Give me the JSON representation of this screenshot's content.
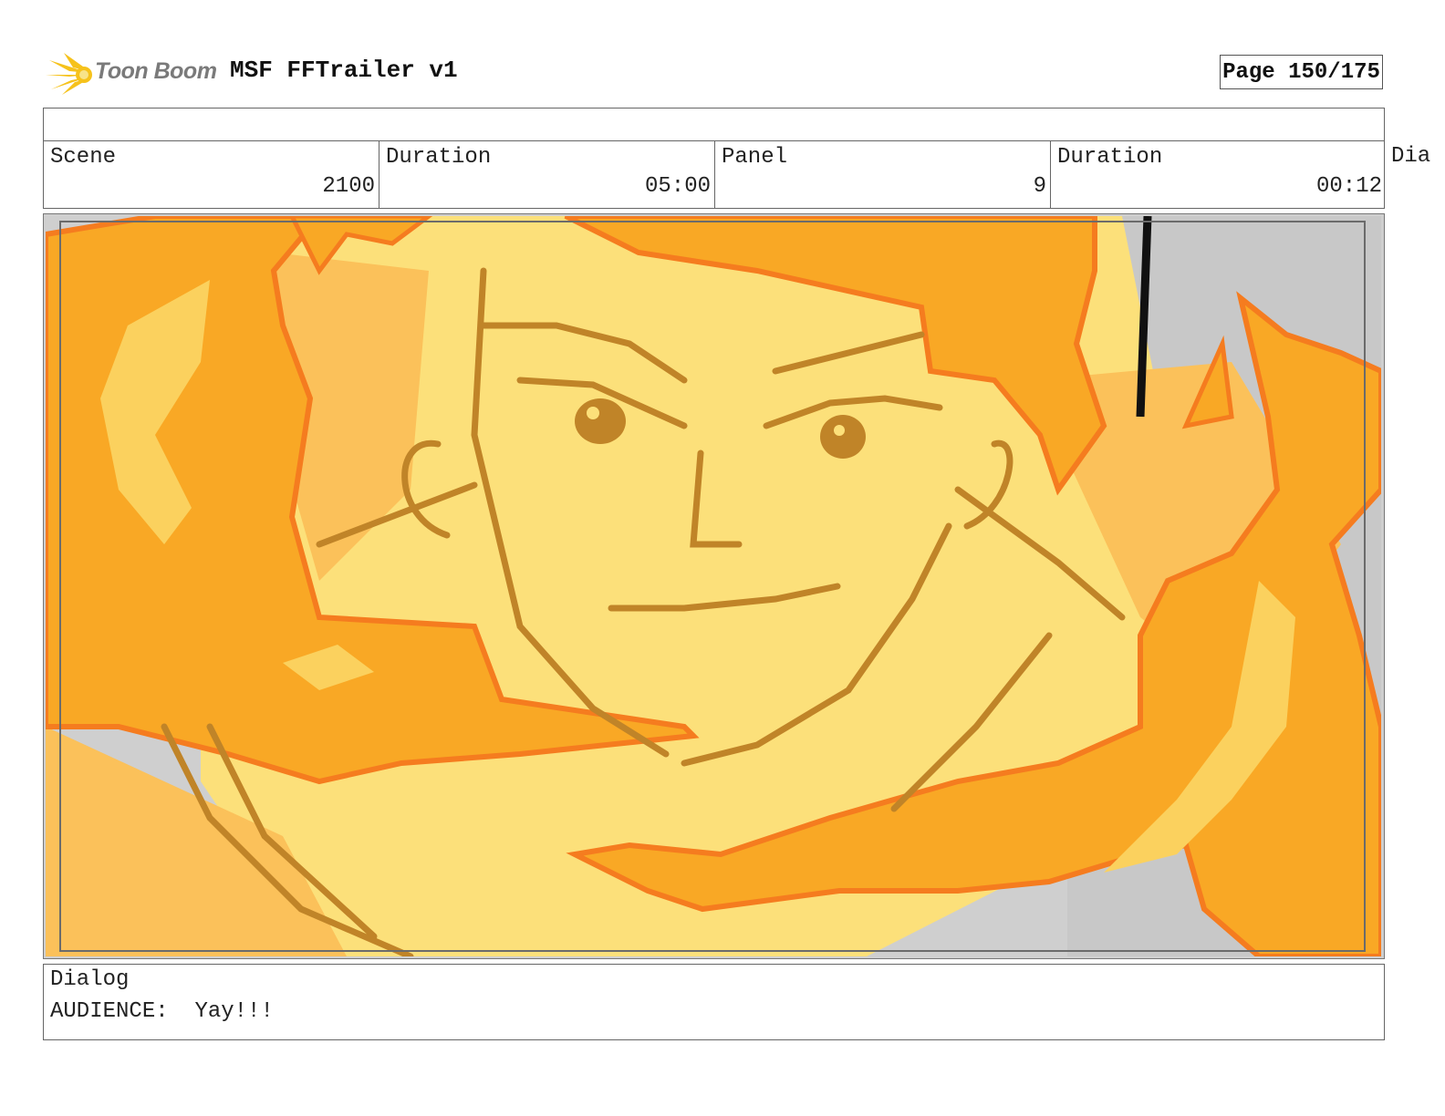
{
  "header": {
    "logo_text": "Toon Boom",
    "project_title": "MSF FFTrailer v1",
    "page_label": "Page 150/175"
  },
  "info": {
    "scene_label": "Scene",
    "scene_value": "2100",
    "scene_duration_label": "Duration",
    "scene_duration_value": "05:00",
    "panel_label": "Panel",
    "panel_value": "9",
    "panel_duration_label": "Duration",
    "panel_duration_value": "00:12",
    "overflow_label": "Dia"
  },
  "dialog": {
    "label": "Dialog",
    "speaker": "AUDIENCE:",
    "line": "Yay!!!"
  },
  "colors": {
    "skin": "#fce07a",
    "flame": "#f9a825",
    "flame_light": "#fbc15a",
    "flame_outline": "#f57c1f",
    "sketch_line": "#c08428",
    "background_grey": "#cfcfcf"
  }
}
